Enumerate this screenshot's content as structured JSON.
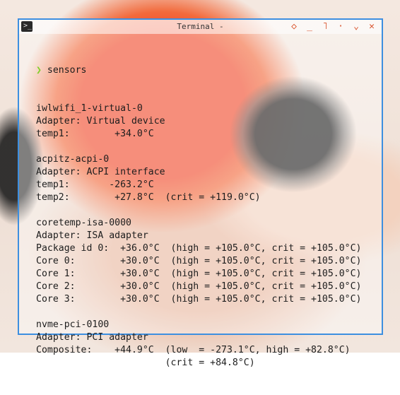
{
  "window": {
    "title": "Terminal -",
    "controls": [
      {
        "name": "diamond-icon",
        "glyph": "◇"
      },
      {
        "name": "minimize-icon",
        "glyph": "_"
      },
      {
        "name": "corner-icon",
        "glyph": "˥"
      },
      {
        "name": "dot-icon",
        "glyph": "·"
      },
      {
        "name": "chevron-down-icon",
        "glyph": "⌄"
      },
      {
        "name": "close-icon",
        "glyph": "✕"
      }
    ],
    "accent": "#3d8fe0",
    "control_color": "#d9532c"
  },
  "prompt": {
    "symbol": "❯",
    "command": "sensors",
    "symbol_color": "#7fd12a"
  },
  "output": [
    "iwlwifi_1-virtual-0",
    "Adapter: Virtual device",
    "temp1:        +34.0°C",
    "",
    "acpitz-acpi-0",
    "Adapter: ACPI interface",
    "temp1:       -263.2°C",
    "temp2:        +27.8°C  (crit = +119.0°C)",
    "",
    "coretemp-isa-0000",
    "Adapter: ISA adapter",
    "Package id 0:  +36.0°C  (high = +105.0°C, crit = +105.0°C)",
    "Core 0:        +30.0°C  (high = +105.0°C, crit = +105.0°C)",
    "Core 1:        +30.0°C  (high = +105.0°C, crit = +105.0°C)",
    "Core 2:        +30.0°C  (high = +105.0°C, crit = +105.0°C)",
    "Core 3:        +30.0°C  (high = +105.0°C, crit = +105.0°C)",
    "",
    "nvme-pci-0100",
    "Adapter: PCI adapter",
    "Composite:    +44.9°C  (low  = -273.1°C, high = +82.8°C)",
    "                       (crit = +84.8°C)"
  ]
}
